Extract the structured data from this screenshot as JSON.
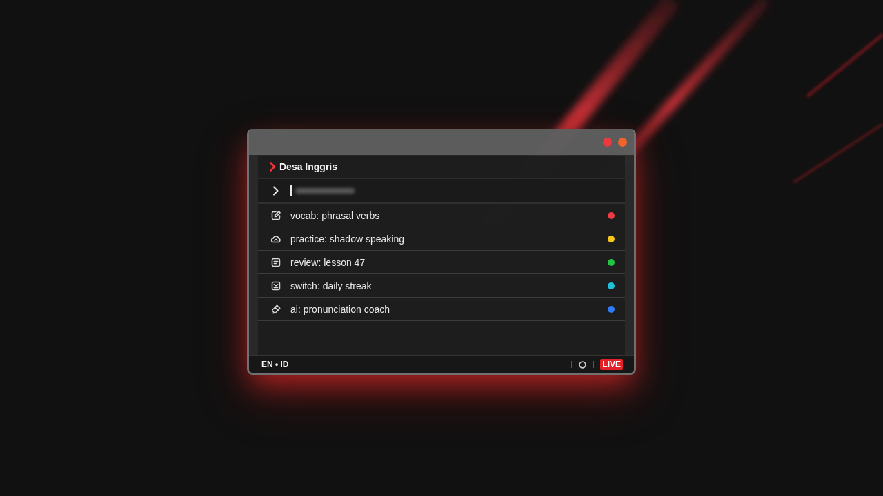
{
  "window": {
    "controls": [
      {
        "color": "#ea3a3f"
      },
      {
        "color": "#f06428"
      }
    ]
  },
  "header": {
    "title": "Desa Inggris"
  },
  "input": {
    "focused": true
  },
  "items": [
    {
      "kind": "vocab",
      "label": "vocab: phrasal verbs",
      "color": "#ef3b43"
    },
    {
      "kind": "practice",
      "label": "practice: shadow speaking",
      "color": "#f6c519"
    },
    {
      "kind": "review",
      "label": "review: lesson 47",
      "color": "#23c444"
    },
    {
      "kind": "switch",
      "label": "switch: daily streak",
      "color": "#1fc2da"
    },
    {
      "kind": "ai",
      "label": "ai: pronunciation coach",
      "color": "#2f7bf3"
    }
  ],
  "status_bar": {
    "languages": "EN • ID",
    "badge": "LIVE"
  }
}
